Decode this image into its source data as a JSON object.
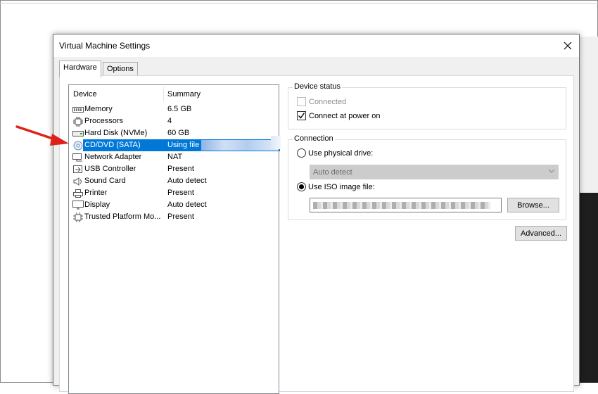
{
  "colors": {
    "accent": "#0078d7",
    "annotation_arrow": "#e0201a"
  },
  "window": {
    "title": "Virtual Machine Settings",
    "close_icon": "close-icon"
  },
  "tabs": [
    {
      "label": "Hardware",
      "active": true
    },
    {
      "label": "Options",
      "active": false
    }
  ],
  "device_list": {
    "headers": {
      "device": "Device",
      "summary": "Summary"
    },
    "rows": [
      {
        "icon": "memory-icon",
        "name": "Memory",
        "summary": "6.5 GB"
      },
      {
        "icon": "processor-icon",
        "name": "Processors",
        "summary": "4"
      },
      {
        "icon": "hard-disk-icon",
        "name": "Hard Disk (NVMe)",
        "summary": "60 GB"
      },
      {
        "icon": "cd-dvd-icon",
        "name": "CD/DVD (SATA)",
        "summary": "Using file I",
        "selected": true
      },
      {
        "icon": "network-adapter-icon",
        "name": "Network Adapter",
        "summary": "NAT"
      },
      {
        "icon": "usb-icon",
        "name": "USB Controller",
        "summary": "Present"
      },
      {
        "icon": "sound-icon",
        "name": "Sound Card",
        "summary": "Auto detect"
      },
      {
        "icon": "printer-icon",
        "name": "Printer",
        "summary": "Present"
      },
      {
        "icon": "display-icon",
        "name": "Display",
        "summary": "Auto detect"
      },
      {
        "icon": "tpm-icon",
        "name": "Trusted Platform Mo...",
        "summary": "Present"
      }
    ]
  },
  "device_status": {
    "legend": "Device status",
    "connected": {
      "label": "Connected",
      "checked": false,
      "disabled": true
    },
    "connect_at_power_on": {
      "label": "Connect at power on",
      "checked": true
    }
  },
  "connection": {
    "legend": "Connection",
    "physical_drive": {
      "label": "Use physical drive:",
      "selected": false
    },
    "physical_drive_select": {
      "value": "Auto detect",
      "disabled": true
    },
    "iso_image": {
      "label": "Use ISO image file:",
      "selected": true
    },
    "browse_label": "Browse..."
  },
  "advanced_label": "Advanced..."
}
